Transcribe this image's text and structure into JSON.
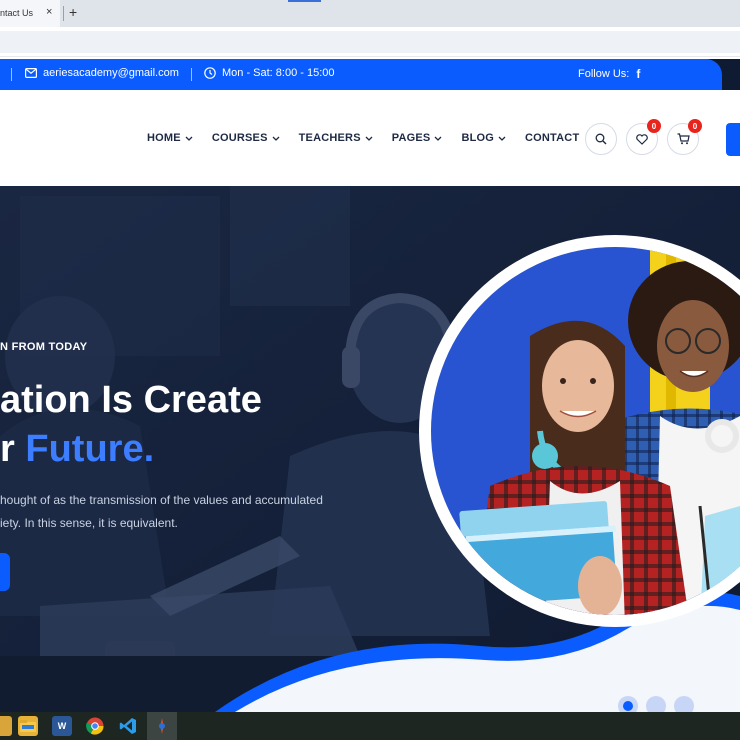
{
  "browser": {
    "tab_title": "ntact Us",
    "tab_close": "×",
    "new_tab": "+"
  },
  "topbar": {
    "email": "aeriesacademy@gmail.com",
    "hours": "Mon - Sat: 8:00 - 15:00",
    "follow_label": "Follow Us:",
    "facebook_glyph": "f"
  },
  "nav": {
    "items": [
      {
        "label": "HOME",
        "has_dropdown": true
      },
      {
        "label": "COURSES",
        "has_dropdown": true
      },
      {
        "label": "TEACHERS",
        "has_dropdown": true
      },
      {
        "label": "PAGES",
        "has_dropdown": true
      },
      {
        "label": "BLOG",
        "has_dropdown": true
      },
      {
        "label": "CONTACT",
        "has_dropdown": false
      }
    ],
    "wishlist_count": "0",
    "cart_count": "0"
  },
  "hero": {
    "subtitle": "N FROM TODAY",
    "headline_line1": "ation Is Create",
    "headline_line2_prefix": "r",
    "headline_line2_highlight": "Future.",
    "description_line1": "hought of as the transmission of the values and accumulated",
    "description_line2": "iety. In this sense, it is equivalent.",
    "slides": 3,
    "active_slide": 1
  },
  "colors": {
    "accent": "#0a5cff",
    "dark": "#14203a",
    "badge": "#e8241d",
    "heading_highlight": "#3d7dff"
  },
  "taskbar": {
    "icons": [
      "file-explorer-icon",
      "word-icon",
      "chrome-icon",
      "vscode-icon",
      "app-icon"
    ],
    "word_letter": "W"
  }
}
